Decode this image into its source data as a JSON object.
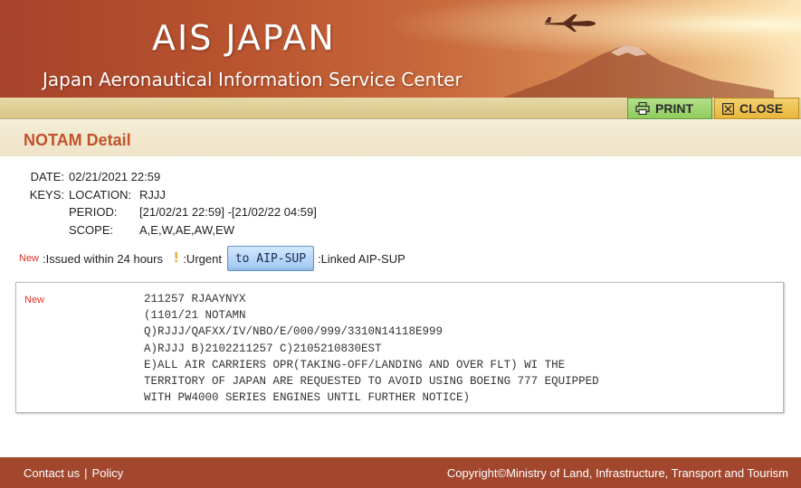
{
  "header": {
    "title": "AIS JAPAN",
    "subtitle": "Japan Aeronautical Information Service Center"
  },
  "toolbar": {
    "print_label": "PRINT",
    "close_label": "CLOSE"
  },
  "page_title": "NOTAM Detail",
  "meta": {
    "date_label": "DATE:",
    "date_value": "02/21/2021 22:59",
    "keys_label": "KEYS:",
    "location_label": "LOCATION:",
    "location_value": "RJJJ",
    "period_label": "PERIOD:",
    "period_value": "[21/02/21 22:59] -[21/02/22 04:59]",
    "scope_label": "SCOPE:",
    "scope_value": "A,E,W,AE,AW,EW"
  },
  "legend": {
    "new_tag": "New",
    "new_desc": ":Issued within 24 hours",
    "urgent_desc": ":Urgent",
    "aipsup_button": "to AIP-SUP",
    "linked_desc": ":Linked AIP-SUP"
  },
  "notam": {
    "new_tag": "New",
    "lines": [
      "211257 RJAAYNYX",
      "(1101/21 NOTAMN",
      "Q)RJJJ/QAFXX/IV/NBO/E/000/999/3310N14118E999",
      "A)RJJJ B)2102211257 C)2105210830EST",
      "E)ALL AIR CARRIERS OPR(TAKING-OFF/LANDING AND OVER FLT) WI THE",
      "TERRITORY OF JAPAN ARE REQUESTED TO AVOID USING BOEING 777 EQUIPPED",
      "WITH PW4000 SERIES ENGINES UNTIL FURTHER NOTICE)"
    ]
  },
  "footer": {
    "contact_label": "Contact us",
    "separator": "|",
    "policy_label": "Policy",
    "copyright": "Copyright©Ministry of Land, Infrastructure, Transport and Tourism"
  },
  "colors": {
    "accent": "#c0532a",
    "footer_bg": "#a2472d",
    "print_bg": "#8fcc5c",
    "close_bg": "#e8b53a",
    "new_tag": "#e0302a"
  },
  "icons": [
    "airplane-icon",
    "printer-icon",
    "close-box-icon",
    "exclamation-icon"
  ]
}
